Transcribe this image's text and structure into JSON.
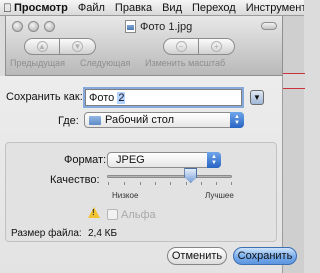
{
  "menubar": {
    "apple_icon": "apple-icon",
    "items": [
      "Просмотр",
      "Файл",
      "Правка",
      "Вид",
      "Переход",
      "Инструменты"
    ]
  },
  "window": {
    "title": "Фото 1.jpg",
    "toolbar": {
      "back_label": "Предыдущая",
      "next_label": "Следующая",
      "zoom_label": "Изменить масштаб"
    }
  },
  "save_dialog": {
    "save_as_label": "Сохранить как:",
    "filename_prefix": "Фото ",
    "filename_selected": "2",
    "where_label": "Где:",
    "where_value": "Рабочий стол",
    "format_label": "Формат:",
    "format_value": "JPEG",
    "quality_label": "Качество:",
    "quality_low": "Низкое",
    "quality_high": "Лучшее",
    "quality_fraction": 0.67,
    "alpha_label": "Альфа",
    "alpha_checked": false,
    "file_size_label": "Размер файла:",
    "file_size_value": "2,4 КБ",
    "cancel_button": "Отменить",
    "save_button": "Сохранить"
  },
  "colors": {
    "accent": "#5d95df",
    "focus_ring": "#86a9dd",
    "warning": "#f1c232"
  }
}
